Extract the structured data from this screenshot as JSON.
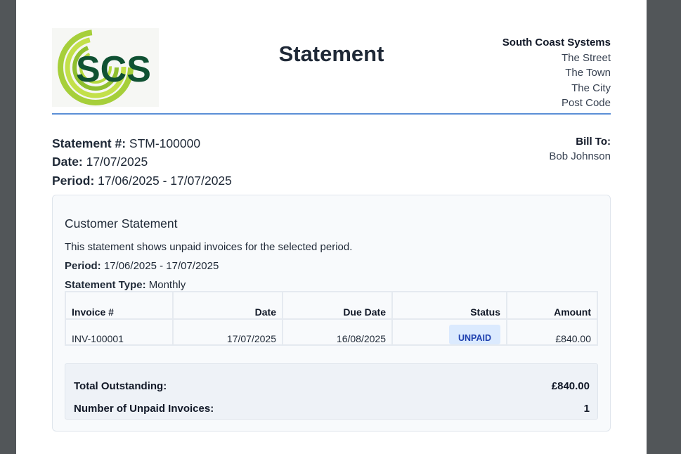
{
  "logo": {
    "text": "SCS",
    "icon": "scs-swirl-logo"
  },
  "document": {
    "title": "Statement"
  },
  "company": {
    "name": "South Coast Systems",
    "address": [
      "The Street",
      "The Town",
      "The City",
      "Post Code"
    ]
  },
  "statement": {
    "number_label": "Statement #:",
    "number": "STM-100000",
    "date_label": "Date:",
    "date": "17/07/2025",
    "period_label": "Period:",
    "period": "17/06/2025 - 17/07/2025"
  },
  "bill_to": {
    "label": "Bill To:",
    "name": "Bob Johnson"
  },
  "panel": {
    "title": "Customer Statement",
    "description": "This statement shows unpaid invoices for the selected period.",
    "period_label": "Period:",
    "period": "17/06/2025 - 17/07/2025",
    "type_label": "Statement Type:",
    "type": "Monthly"
  },
  "invoice_table": {
    "headers": [
      "Invoice #",
      "Date",
      "Due Date",
      "Status",
      "Amount"
    ],
    "rows": [
      {
        "invoice": "INV-100001",
        "date": "17/07/2025",
        "due_date": "16/08/2025",
        "status": "UNPAID",
        "amount": "£840.00"
      }
    ]
  },
  "totals": {
    "outstanding_label": "Total Outstanding:",
    "outstanding": "£840.00",
    "count_label": "Number of Unpaid Invoices:",
    "count": "1"
  },
  "colors": {
    "accent_rule": "#5b8fd6",
    "badge_bg": "#dbeafe",
    "badge_text": "#1e40af",
    "logo_green": "#9bc53d",
    "logo_dark": "#0f5132"
  }
}
